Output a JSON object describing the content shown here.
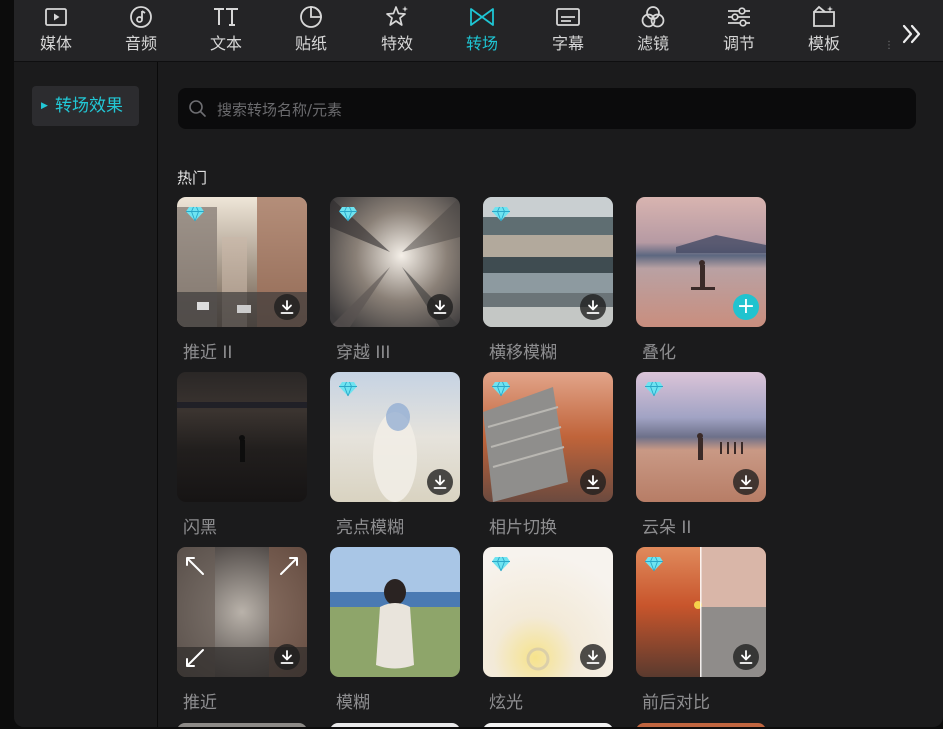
{
  "toolbar": {
    "tabs": [
      {
        "label": "媒体",
        "icon": "media-icon"
      },
      {
        "label": "音频",
        "icon": "audio-icon"
      },
      {
        "label": "文本",
        "icon": "text-icon"
      },
      {
        "label": "贴纸",
        "icon": "sticker-icon"
      },
      {
        "label": "特效",
        "icon": "effects-icon"
      },
      {
        "label": "转场",
        "icon": "transition-icon",
        "active": true
      },
      {
        "label": "字幕",
        "icon": "subtitle-icon"
      },
      {
        "label": "滤镜",
        "icon": "filter-icon"
      },
      {
        "label": "调节",
        "icon": "adjust-icon"
      },
      {
        "label": "模板",
        "icon": "template-icon"
      }
    ],
    "more_icon": "double-chevron-right-icon"
  },
  "sidebar": {
    "items": [
      {
        "label": "转场效果",
        "active": true
      }
    ]
  },
  "search": {
    "placeholder": "搜索转场名称/元素",
    "value": ""
  },
  "section": {
    "title": "热门"
  },
  "transitions": [
    {
      "name": "推近 II",
      "premium": true,
      "action": "download"
    },
    {
      "name": "穿越 III",
      "premium": true,
      "action": "download"
    },
    {
      "name": "横移模糊",
      "premium": true,
      "action": "download"
    },
    {
      "name": "叠化",
      "premium": false,
      "action": "add"
    },
    {
      "name": "闪黑",
      "premium": false,
      "action": "none"
    },
    {
      "name": "亮点模糊",
      "premium": true,
      "action": "download"
    },
    {
      "name": "相片切换",
      "premium": true,
      "action": "download"
    },
    {
      "name": "云朵 II",
      "premium": true,
      "action": "download"
    },
    {
      "name": "推近",
      "premium": false,
      "action": "download"
    },
    {
      "name": "模糊",
      "premium": false,
      "action": "none"
    },
    {
      "name": "炫光",
      "premium": true,
      "action": "download"
    },
    {
      "name": "前后对比",
      "premium": true,
      "action": "download"
    }
  ],
  "colors": {
    "accent": "#1ec5d3",
    "background": "#1b1b1c",
    "toolbar": "#242426"
  }
}
